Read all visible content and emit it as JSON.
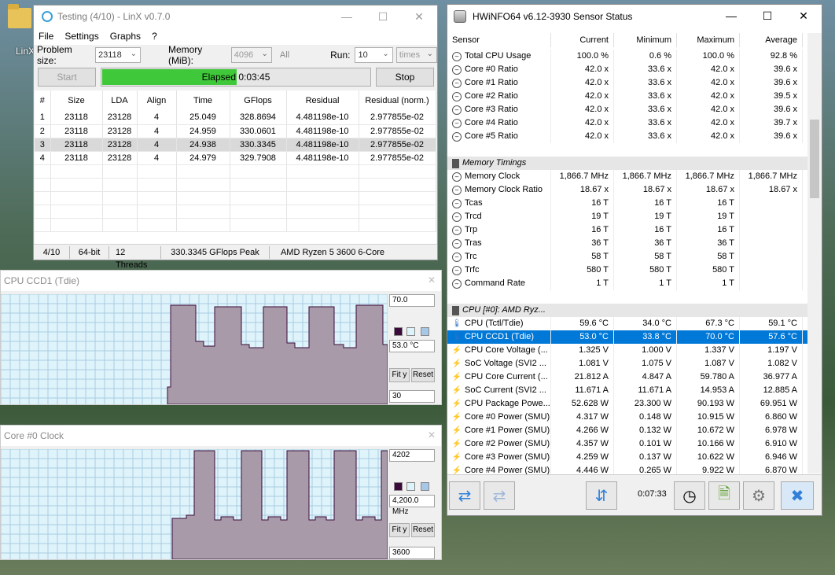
{
  "desktop": {
    "icon_label": "LinX"
  },
  "linx": {
    "title": "Testing (4/10) - LinX v0.7.0",
    "menu": [
      "File",
      "Settings",
      "Graphs",
      "?"
    ],
    "problem_size_label": "Problem size:",
    "problem_size": "23118",
    "memory_label": "Memory (MiB):",
    "memory": "4096",
    "all_label": "All",
    "run_label": "Run:",
    "run": "10",
    "run_unit": "times",
    "start_label": "Start",
    "elapsed": "Elapsed 0:03:45",
    "progress_fraction": 0.5,
    "stop_label": "Stop",
    "columns": [
      "#",
      "Size",
      "LDA",
      "Align",
      "Time",
      "GFlops",
      "Residual",
      "Residual (norm.)"
    ],
    "rows": [
      [
        "1",
        "23118",
        "23128",
        "4",
        "25.049",
        "328.8694",
        "4.481198e-10",
        "2.977855e-02"
      ],
      [
        "2",
        "23118",
        "23128",
        "4",
        "24.959",
        "330.0601",
        "4.481198e-10",
        "2.977855e-02"
      ],
      [
        "3",
        "23118",
        "23128",
        "4",
        "24.938",
        "330.3345",
        "4.481198e-10",
        "2.977855e-02"
      ],
      [
        "4",
        "23118",
        "23128",
        "4",
        "24.979",
        "329.7908",
        "4.481198e-10",
        "2.977855e-02"
      ]
    ],
    "status": [
      "4/10",
      "64-bit",
      "12 Threads",
      "330.3345 GFlops Peak",
      "AMD Ryzen 5 3600 6-Core"
    ]
  },
  "graph1": {
    "title": "CPU CCD1 (Tdie)",
    "max": "70.0",
    "current": "53.0 °C",
    "min": "30",
    "fit_label": "Fit y",
    "reset_label": "Reset",
    "line_color": "#a89aa8"
  },
  "graph2": {
    "title": "Core #0 Clock",
    "max": "4202",
    "current": "4,200.0 MHz",
    "min": "3600",
    "fit_label": "Fit y",
    "reset_label": "Reset"
  },
  "hwinfo": {
    "title": "HWiNFO64 v6.12-3930 Sensor Status",
    "columns": [
      "Sensor",
      "Current",
      "Minimum",
      "Maximum",
      "Average"
    ],
    "rows": [
      {
        "type": "row",
        "icon": "clock",
        "name": "Total CPU Usage",
        "cur": "100.0 %",
        "min": "0.6 %",
        "max": "100.0 %",
        "avg": "92.8 %"
      },
      {
        "type": "row",
        "icon": "clock",
        "name": "Core #0 Ratio",
        "cur": "42.0 x",
        "min": "33.6 x",
        "max": "42.0 x",
        "avg": "39.6 x"
      },
      {
        "type": "row",
        "icon": "clock",
        "name": "Core #1 Ratio",
        "cur": "42.0 x",
        "min": "33.6 x",
        "max": "42.0 x",
        "avg": "39.6 x"
      },
      {
        "type": "row",
        "icon": "clock",
        "name": "Core #2 Ratio",
        "cur": "42.0 x",
        "min": "33.6 x",
        "max": "42.0 x",
        "avg": "39.5 x"
      },
      {
        "type": "row",
        "icon": "clock",
        "name": "Core #3 Ratio",
        "cur": "42.0 x",
        "min": "33.6 x",
        "max": "42.0 x",
        "avg": "39.6 x"
      },
      {
        "type": "row",
        "icon": "clock",
        "name": "Core #4 Ratio",
        "cur": "42.0 x",
        "min": "33.6 x",
        "max": "42.0 x",
        "avg": "39.7 x"
      },
      {
        "type": "row",
        "icon": "clock",
        "name": "Core #5 Ratio",
        "cur": "42.0 x",
        "min": "33.6 x",
        "max": "42.0 x",
        "avg": "39.6 x"
      },
      {
        "type": "blank"
      },
      {
        "type": "group",
        "name": "Memory Timings"
      },
      {
        "type": "row",
        "icon": "clock",
        "name": "Memory Clock",
        "cur": "1,866.7 MHz",
        "min": "1,866.7 MHz",
        "max": "1,866.7 MHz",
        "avg": "1,866.7 MHz"
      },
      {
        "type": "row",
        "icon": "clock",
        "name": "Memory Clock Ratio",
        "cur": "18.67 x",
        "min": "18.67 x",
        "max": "18.67 x",
        "avg": "18.67 x"
      },
      {
        "type": "row",
        "icon": "clock",
        "name": "Tcas",
        "cur": "16 T",
        "min": "16 T",
        "max": "16 T",
        "avg": ""
      },
      {
        "type": "row",
        "icon": "clock",
        "name": "Trcd",
        "cur": "19 T",
        "min": "19 T",
        "max": "19 T",
        "avg": ""
      },
      {
        "type": "row",
        "icon": "clock",
        "name": "Trp",
        "cur": "16 T",
        "min": "16 T",
        "max": "16 T",
        "avg": ""
      },
      {
        "type": "row",
        "icon": "clock",
        "name": "Tras",
        "cur": "36 T",
        "min": "36 T",
        "max": "36 T",
        "avg": ""
      },
      {
        "type": "row",
        "icon": "clock",
        "name": "Trc",
        "cur": "58 T",
        "min": "58 T",
        "max": "58 T",
        "avg": ""
      },
      {
        "type": "row",
        "icon": "clock",
        "name": "Trfc",
        "cur": "580 T",
        "min": "580 T",
        "max": "580 T",
        "avg": ""
      },
      {
        "type": "row",
        "icon": "clock",
        "name": "Command Rate",
        "cur": "1 T",
        "min": "1 T",
        "max": "1 T",
        "avg": ""
      },
      {
        "type": "blank"
      },
      {
        "type": "group",
        "name": "CPU [#0]: AMD Ryz..."
      },
      {
        "type": "row",
        "icon": "therm",
        "name": "CPU (Tctl/Tdie)",
        "cur": "59.6 °C",
        "min": "34.0 °C",
        "max": "67.3 °C",
        "avg": "59.1 °C"
      },
      {
        "type": "row",
        "icon": "therm",
        "name": "CPU CCD1 (Tdie)",
        "cur": "53.0 °C",
        "min": "33.8 °C",
        "max": "70.0 °C",
        "avg": "57.6 °C",
        "selected": true
      },
      {
        "type": "row",
        "icon": "bolt",
        "name": "CPU Core Voltage (...",
        "cur": "1.325 V",
        "min": "1.000 V",
        "max": "1.337 V",
        "avg": "1.197 V"
      },
      {
        "type": "row",
        "icon": "bolt",
        "name": "SoC Voltage (SVI2 ...",
        "cur": "1.081 V",
        "min": "1.075 V",
        "max": "1.087 V",
        "avg": "1.082 V"
      },
      {
        "type": "row",
        "icon": "bolt",
        "name": "CPU Core Current (...",
        "cur": "21.812 A",
        "min": "4.847 A",
        "max": "59.780 A",
        "avg": "36.977 A"
      },
      {
        "type": "row",
        "icon": "bolt",
        "name": "SoC Current (SVI2 ...",
        "cur": "11.671 A",
        "min": "11.671 A",
        "max": "14.953 A",
        "avg": "12.885 A"
      },
      {
        "type": "row",
        "icon": "bolt",
        "name": "CPU Package Powe...",
        "cur": "52.628 W",
        "min": "23.300 W",
        "max": "90.193 W",
        "avg": "69.951 W"
      },
      {
        "type": "row",
        "icon": "bolt",
        "name": "Core #0 Power (SMU)",
        "cur": "4.317 W",
        "min": "0.148 W",
        "max": "10.915 W",
        "avg": "6.860 W"
      },
      {
        "type": "row",
        "icon": "bolt",
        "name": "Core #1 Power (SMU)",
        "cur": "4.266 W",
        "min": "0.132 W",
        "max": "10.672 W",
        "avg": "6.978 W"
      },
      {
        "type": "row",
        "icon": "bolt",
        "name": "Core #2 Power (SMU)",
        "cur": "4.357 W",
        "min": "0.101 W",
        "max": "10.166 W",
        "avg": "6.910 W"
      },
      {
        "type": "row",
        "icon": "bolt",
        "name": "Core #3 Power (SMU)",
        "cur": "4.259 W",
        "min": "0.137 W",
        "max": "10.622 W",
        "avg": "6.946 W"
      },
      {
        "type": "row",
        "icon": "bolt",
        "name": "Core #4 Power (SMU)",
        "cur": "4.446 W",
        "min": "0.265 W",
        "max": "9.922 W",
        "avg": "6.870 W"
      }
    ],
    "timer": "0:07:33",
    "accent": "#0078d7"
  }
}
